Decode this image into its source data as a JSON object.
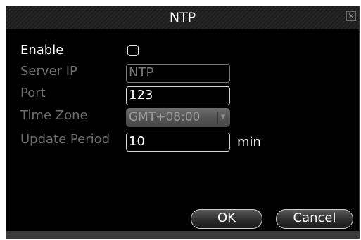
{
  "window": {
    "title": "NTP",
    "close_symbol": "✕"
  },
  "form": {
    "enable": {
      "label": "Enable",
      "checked": false
    },
    "server_ip": {
      "label": "Server IP",
      "value": "NTP"
    },
    "port": {
      "label": "Port",
      "value": "123"
    },
    "time_zone": {
      "label": "Time Zone",
      "value": "GMT+08:00"
    },
    "update_period": {
      "label": "Update Period",
      "value": "10",
      "unit": "min"
    }
  },
  "buttons": {
    "ok": "OK",
    "cancel": "Cancel"
  }
}
